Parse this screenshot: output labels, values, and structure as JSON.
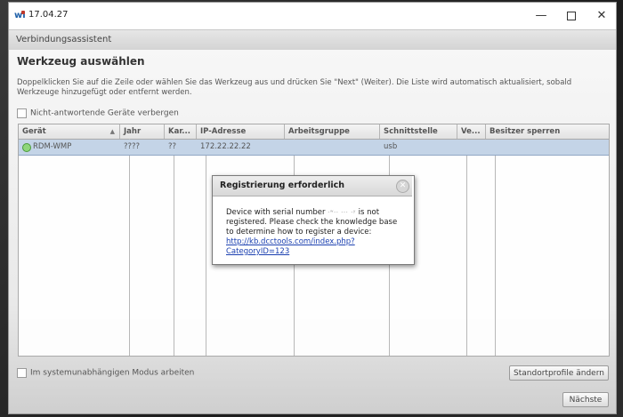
{
  "window": {
    "title": "17.04.27",
    "app_icon_text": "wi",
    "controls": {
      "minimize": "—",
      "close": "✕"
    }
  },
  "header": {
    "label": "Verbindungsassistent"
  },
  "page": {
    "heading": "Werkzeug auswählen",
    "instructions": "Doppelklicken Sie auf die Zeile oder wählen Sie das Werkzeug aus und drücken Sie \"Next\" (Weiter).  Die Liste wird automatisch aktualisiert, sobald Werkzeuge hinzugefügt oder entfernt werden.",
    "hide_nonresponding_label": "Nicht-antwortende Geräte verbergen",
    "standalone_mode_label": "Im systemunabhängigen Modus arbeiten",
    "profile_button": "Standortprofile ändern",
    "next_button": "Nächste"
  },
  "table": {
    "columns": [
      "Gerät",
      "Jahr",
      "Kar...",
      "IP-Adresse",
      "Arbeitsgruppe",
      "Schnittstelle",
      "Ve...",
      "Besitzer sperren"
    ],
    "sort_indicator": "▲",
    "rows": [
      {
        "device": "RDM-WMP",
        "year": "????",
        "kar": "??",
        "ip": "172.22.22.22",
        "workgroup": "",
        "interface": "usb",
        "ve": "",
        "owner_lock": "",
        "status_color": "#8fd67a"
      }
    ]
  },
  "dialog": {
    "title": "Registrierung erforderlich",
    "close_symbol": "✕",
    "text_before": "Device with serial number ",
    "redacted_serial": "·ʷ·· ··· ·ʸ",
    "text_after": " is not registered. Please check the knowledge base to determine how to register a device:",
    "link": "http://kb.dcctools.com/index.php?CategoryID=123",
    "link_line1": "http://kb.dcctools.com/index.php?",
    "link_line2": "CategoryID=123"
  }
}
